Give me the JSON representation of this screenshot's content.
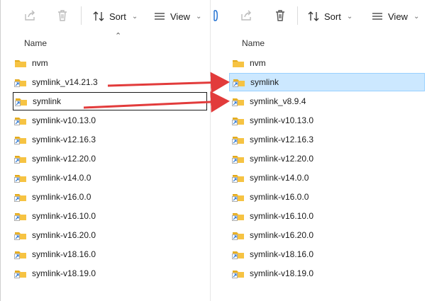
{
  "toolbar": {
    "sort_label": "Sort",
    "view_label": "View"
  },
  "columns": {
    "name_label": "Name"
  },
  "left_pane": {
    "rows": [
      {
        "label": "nvm",
        "shortcut": false
      },
      {
        "label": "symlink_v14.21.3",
        "shortcut": true
      },
      {
        "label": "symlink",
        "shortcut": true
      },
      {
        "label": "symlink-v10.13.0",
        "shortcut": true
      },
      {
        "label": "symlink-v12.16.3",
        "shortcut": true
      },
      {
        "label": "symlink-v12.20.0",
        "shortcut": true
      },
      {
        "label": "symlink-v14.0.0",
        "shortcut": true
      },
      {
        "label": "symlink-v16.0.0",
        "shortcut": true
      },
      {
        "label": "symlink-v16.10.0",
        "shortcut": true
      },
      {
        "label": "symlink-v16.20.0",
        "shortcut": true
      },
      {
        "label": "symlink-v18.16.0",
        "shortcut": true
      },
      {
        "label": "symlink-v18.19.0",
        "shortcut": true
      }
    ]
  },
  "right_pane": {
    "rows": [
      {
        "label": "nvm",
        "shortcut": false
      },
      {
        "label": "symlink",
        "shortcut": true
      },
      {
        "label": "symlink_v8.9.4",
        "shortcut": true
      },
      {
        "label": "symlink-v10.13.0",
        "shortcut": true
      },
      {
        "label": "symlink-v12.16.3",
        "shortcut": true
      },
      {
        "label": "symlink-v12.20.0",
        "shortcut": true
      },
      {
        "label": "symlink-v14.0.0",
        "shortcut": true
      },
      {
        "label": "symlink-v16.0.0",
        "shortcut": true
      },
      {
        "label": "symlink-v16.10.0",
        "shortcut": true
      },
      {
        "label": "symlink-v16.20.0",
        "shortcut": true
      },
      {
        "label": "symlink-v18.16.0",
        "shortcut": true
      },
      {
        "label": "symlink-v18.19.0",
        "shortcut": true
      }
    ]
  },
  "icons": {
    "share": "share-icon",
    "delete": "delete-icon",
    "sort": "sort-icon",
    "view": "view-icon",
    "folder": "folder-icon",
    "shortcut": "shortcut-overlay-icon"
  },
  "colors": {
    "folder": "#f6c343",
    "folder_dark": "#e2a91b",
    "selection": "#cce8ff",
    "arrow": "#e23b3b"
  }
}
